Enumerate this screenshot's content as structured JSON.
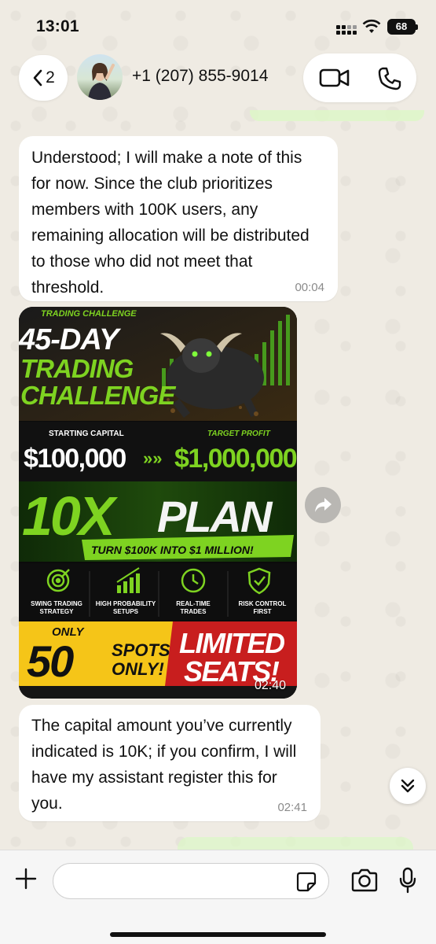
{
  "status_bar": {
    "time": "13:01",
    "battery": "68"
  },
  "header": {
    "back_count": "2",
    "contact_name": "+1 (207) 855-9014"
  },
  "messages": [
    {
      "text": "Understood; I will make a note of this for now. Since the club prioritizes members with 100K users, any remaining allocation will be distributed to those who did not meet that threshold.",
      "time": "00:04"
    },
    {
      "type": "image",
      "time": "02:40",
      "flyer": {
        "banner": "TRADING CHALLENGE",
        "title_line1": "45-DAY",
        "title_line2": "TRADING",
        "title_line3": "CHALLENGE",
        "starting_label": "STARTING CAPITAL",
        "target_label": "TARGET PROFIT",
        "starting_value": "$100,000",
        "arrows": "»»",
        "target_value": "$1,000,000",
        "plan_10x": "10X",
        "plan_word": "PLAN",
        "tagline": "TURN $100K INTO $1 MILLION!",
        "features": [
          {
            "label": "SWING TRADING STRATEGY",
            "icon": "target-icon"
          },
          {
            "label": "HIGH PROBABILITY SETUPS",
            "icon": "bar-chart-icon"
          },
          {
            "label": "REAL-TIME TRADES",
            "icon": "clock-icon"
          },
          {
            "label": "RISK CONTROL FIRST",
            "icon": "shield-check-icon"
          }
        ],
        "only_label": "ONLY",
        "spots_number": "50",
        "spots_label": "SPOTS",
        "only_label2": "ONLY!",
        "limited_label": "LIMITED",
        "seats_label": "SEATS!"
      }
    },
    {
      "text": "The capital amount you’ve currently indicated is 10K; if you confirm, I will have my assistant register this for you.",
      "time": "02:41"
    }
  ],
  "composer": {
    "placeholder": ""
  },
  "colors": {
    "accent_green": "#7ed321",
    "flyer_yellow": "#f5c518",
    "flyer_red": "#c81e1e",
    "sent_bubble": "#dcf8c6"
  }
}
